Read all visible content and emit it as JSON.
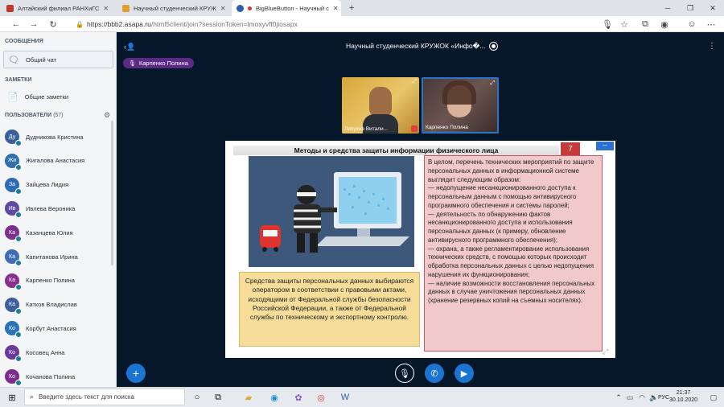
{
  "browser": {
    "tabs": [
      {
        "title": "Алтайский филиал РАНХиГС",
        "active": false
      },
      {
        "title": "Научный студенческий КРУЖ",
        "active": false
      },
      {
        "title": "BigBlueButton - Научный с",
        "active": true
      }
    ],
    "new_tab": "+",
    "url_host": "https://bbb2.asapa.ru",
    "url_path": "/html5client/join?sessionToken=lmoxyvff0jiosapx"
  },
  "sidebar": {
    "messages_header": "СООБЩЕНИЯ",
    "public_chat": "Общий чат",
    "notes_header": "ЗАМЕТКИ",
    "shared_notes": "Общие заметки",
    "users_header": "ПОЛЬЗОВАТЕЛИ",
    "users_count": "(57)",
    "users": [
      {
        "initials": "Ду",
        "name": "Дудникова Кристина",
        "color": "#3a5f9e"
      },
      {
        "initials": "Жи",
        "name": "Жигалова Анастасия",
        "color": "#2f6fae"
      },
      {
        "initials": "За",
        "name": "Зайцева Лидия",
        "color": "#2d6cb5"
      },
      {
        "initials": "Ив",
        "name": "Ивлева Вероника",
        "color": "#5f4aa2"
      },
      {
        "initials": "Ка",
        "name": "Казанцева Юлия",
        "color": "#7b2f8f"
      },
      {
        "initials": "Ка",
        "name": "Капитанова Ирина",
        "color": "#3d6db3"
      },
      {
        "initials": "Ка",
        "name": "Карпенко Полина",
        "color": "#8a2f92"
      },
      {
        "initials": "Ка",
        "name": "Катков Владислав",
        "color": "#3d5f9c"
      },
      {
        "initials": "Ко",
        "name": "Корбут Анастасия",
        "color": "#2c73b8"
      },
      {
        "initials": "Ко",
        "name": "Косовец Анна",
        "color": "#6a3a98"
      },
      {
        "initials": "Ко",
        "name": "Кочанова Полина",
        "color": "#7a2d8c"
      }
    ]
  },
  "meeting": {
    "title": "Научный студенческий КРУЖОК «Инфо�...",
    "talking": "Карпенко Полина",
    "videos": [
      {
        "name": "Лопухов Витали..."
      },
      {
        "name": "Карпенко Полина"
      }
    ]
  },
  "slide": {
    "title": "Методы и средства защиты информации физического лица",
    "number": "7",
    "yellow_text": "Средства защиты персональных данных выбираются оператором в соответствии с правовыми актами, исходящими от Федеральной службы безопасности Российской Федерации, а также от Федеральной службы по техническому и экспортному контролю.",
    "pink_text": "В целом, перечень технических мероприятий по защите персональных данных в информационной системе выглядит следующим образом:\n— недопущение несанкционированного доступа к персональным данным с помощью антивирусного программного обеспечения и системы паролей;\n— деятельность по обнаружению фактов несанкционированного доступа и использования персональных данных (к примеру, обновление антивирусного программного обеспечения);\n— охрана, а также регламентирование использования технических средств, с помощью которых происходит обработка персональных данных с целью недопущения нарушения их функционирования;\n— наличие возможности восстановления персональных данных в случае уничтожения персональных данных (хранение резервных копий на съемных носителях)."
  },
  "taskbar": {
    "search_placeholder": "Введите здесь текст для поиска",
    "lang": "РУС",
    "time": "21:37",
    "date": "30.10.2020"
  }
}
